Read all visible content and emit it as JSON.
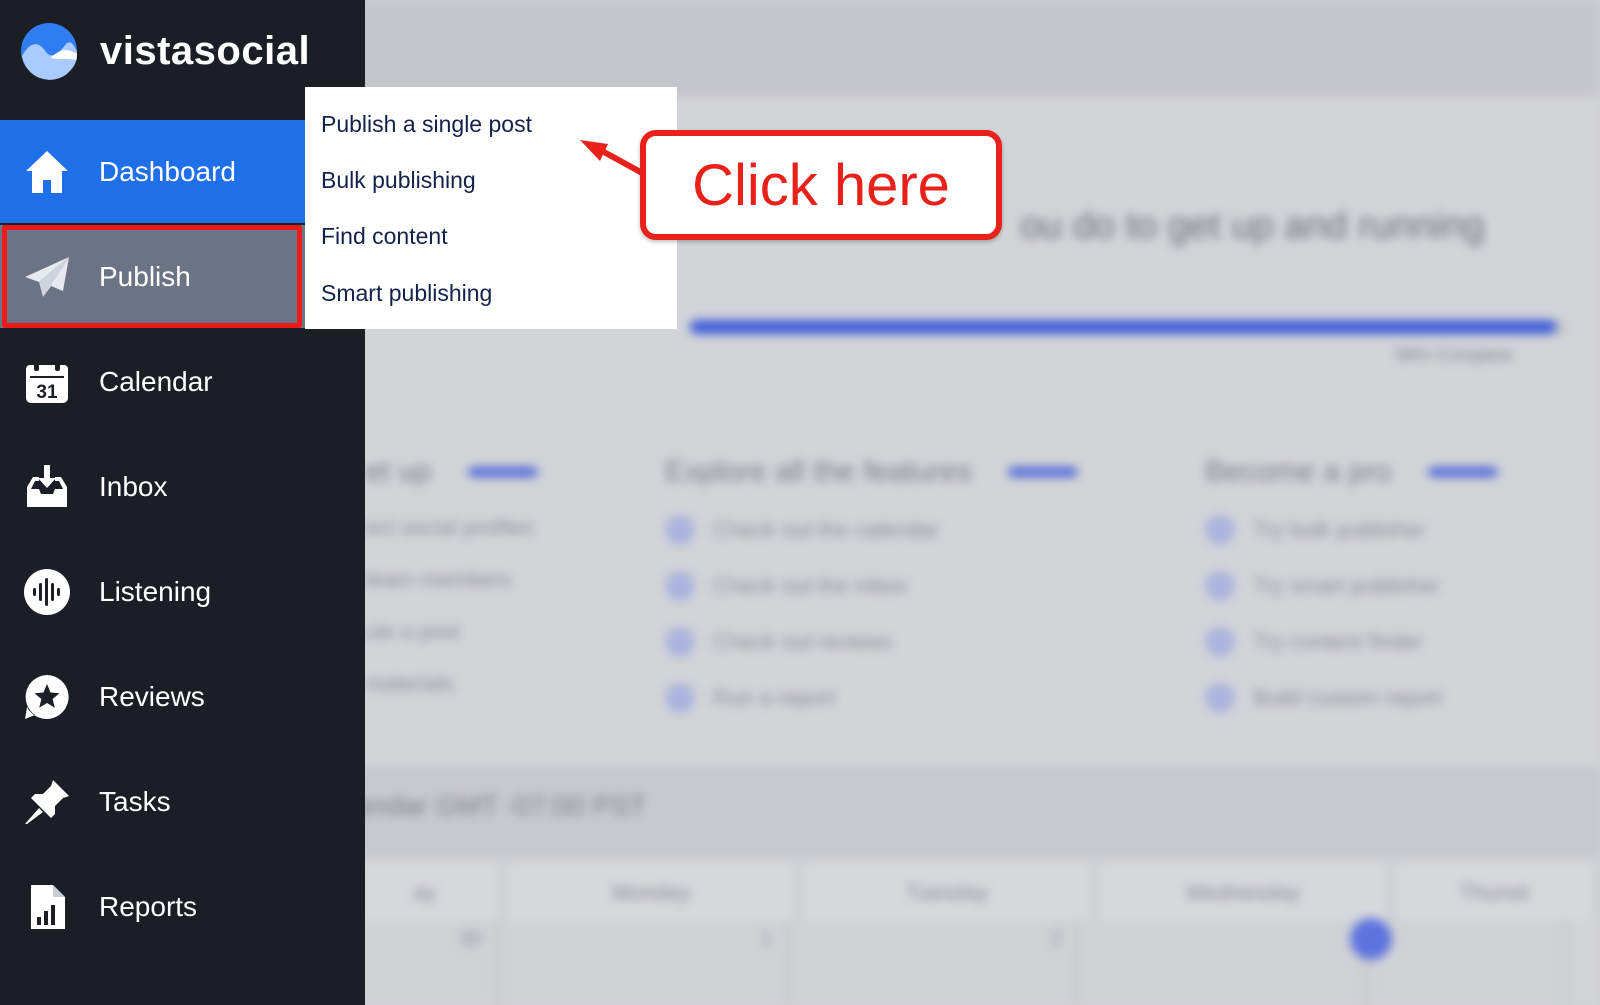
{
  "brand": {
    "name": "vistasocial",
    "logo_icon": "wave-logo-icon"
  },
  "sidebar": {
    "items": [
      {
        "label": "Dashboard",
        "icon": "home-icon",
        "state": "active"
      },
      {
        "label": "Publish",
        "icon": "paper-plane-icon",
        "state": "hover"
      },
      {
        "label": "Calendar",
        "icon": "calendar-icon",
        "icon_text": "31"
      },
      {
        "label": "Inbox",
        "icon": "inbox-icon"
      },
      {
        "label": "Listening",
        "icon": "sound-wave-icon"
      },
      {
        "label": "Reviews",
        "icon": "star-badge-icon"
      },
      {
        "label": "Tasks",
        "icon": "pushpin-icon"
      },
      {
        "label": "Reports",
        "icon": "report-chart-icon"
      }
    ]
  },
  "publish_menu": {
    "items": [
      "Publish a single post",
      "Bulk publishing",
      "Find content",
      "Smart publishing"
    ]
  },
  "annotation": {
    "callout_text": "Click here",
    "color": "#e8221a"
  },
  "background": {
    "heading": "ou do to get up and running",
    "progress_label": "99% Complete",
    "progress_value": 0.99,
    "columns": [
      {
        "title": "et up",
        "items": [
          "ect social profiles",
          "team members",
          "ule a post",
          "materials"
        ]
      },
      {
        "title": "Explore all the features",
        "items": [
          "Check out the calendar",
          "Check out the inbox",
          "Check out reviews",
          "Run a report"
        ]
      },
      {
        "title": "Become a pro",
        "items": [
          "Try bulk publisher",
          "Try smart publisher",
          "Try content finder",
          "Build custom report"
        ]
      }
    ],
    "calendar_title": "lendar  GMT -07:00 PST",
    "calendar_days": [
      "ay",
      "Monday",
      "Tuesday",
      "Wednesday",
      "Thursd"
    ],
    "calendar_dates": [
      "30",
      "1",
      "2",
      "",
      ""
    ]
  },
  "colors": {
    "sidebar_bg": "#1c1e26",
    "active_bg": "#1f6fe8",
    "hover_bg": "#6a7485",
    "menu_text": "#14214a",
    "progress": "#3b5bd9"
  }
}
